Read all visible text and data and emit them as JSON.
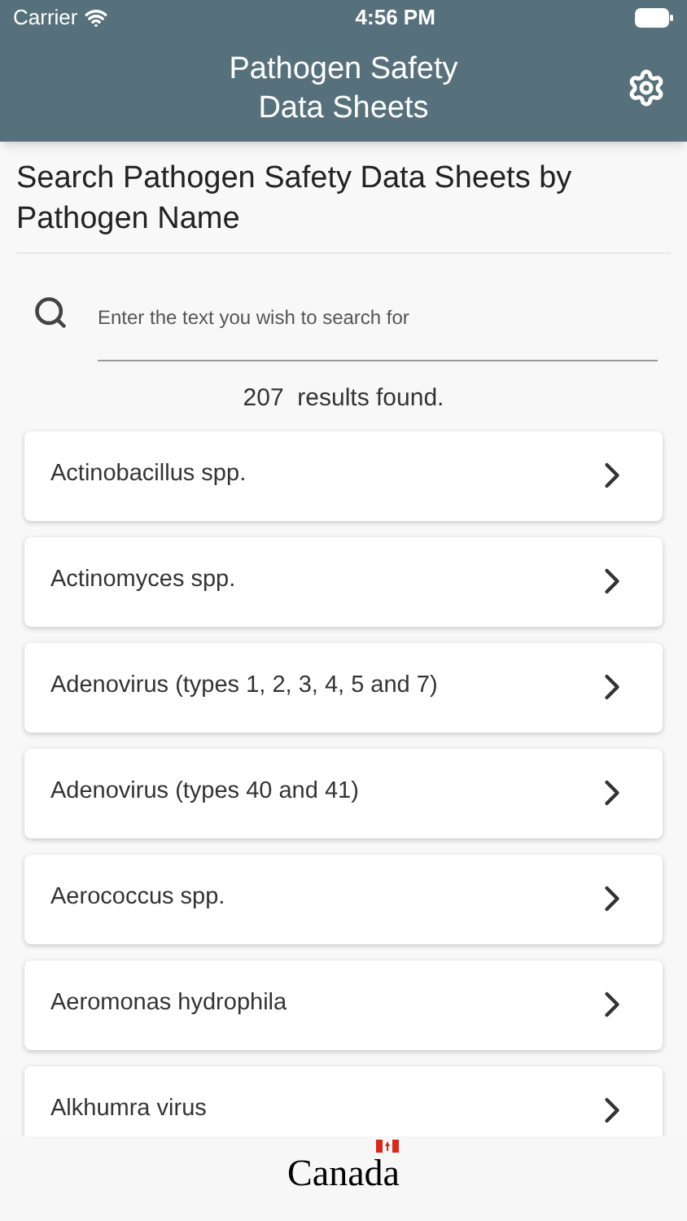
{
  "status_bar": {
    "carrier": "Carrier",
    "time": "4:56 PM"
  },
  "header": {
    "title": "Pathogen Safety Data Sheets"
  },
  "heading": "Search Pathogen Safety Data Sheets by Pathogen Name",
  "search": {
    "placeholder": "Enter the text you wish to search for"
  },
  "results": {
    "count": "207",
    "label": "results found."
  },
  "pathogens": [
    {
      "name": "Actinobacillus spp."
    },
    {
      "name": "Actinomyces spp."
    },
    {
      "name": "Adenovirus (types 1, 2, 3, 4, 5 and 7)"
    },
    {
      "name": "Adenovirus (types 40 and 41)"
    },
    {
      "name": "Aerococcus spp."
    },
    {
      "name": "Aeromonas hydrophila"
    },
    {
      "name": "Alkhumra virus"
    }
  ],
  "footer": {
    "wordmark": "Canada"
  }
}
